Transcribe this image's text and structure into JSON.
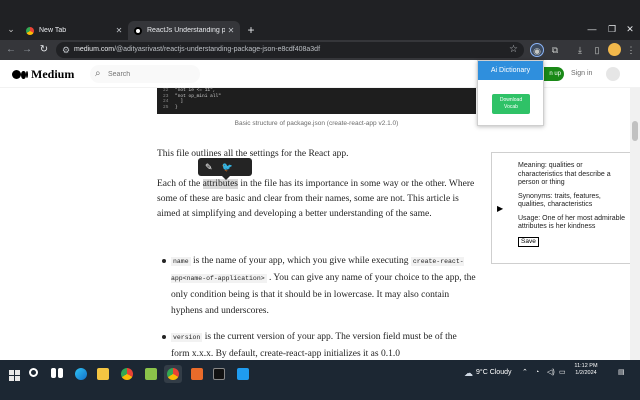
{
  "browser": {
    "tabs": [
      {
        "title": "New Tab",
        "active": false
      },
      {
        "title": "ReactJs Understanding packag",
        "active": true
      }
    ],
    "url_domain": "medium.com",
    "url_path": "/@adityasrivast/reactjs-understanding-package-json-e8cdf408a3df"
  },
  "medium": {
    "logo_text": "Medium",
    "search_placeholder": "Search",
    "signup_label": "n up",
    "signin_label": "Sign in"
  },
  "article": {
    "code_lines": [
      {
        "no": "22",
        "text": "\"not ie <= 11\","
      },
      {
        "no": "23",
        "text": "\"not op_mini all\""
      },
      {
        "no": "24",
        "text": "  ]"
      },
      {
        "no": "25",
        "text": "}"
      }
    ],
    "caption": "Basic structure of package.json (create-react-app v2.1.0)",
    "para1": "This file outlines all the settings for the React app.",
    "para2_before": "Each of the ",
    "para2_highlight": "attributes",
    "para2_after": " in the file has its importance in some way or the other. Where some of these are basic and clear from their names, some are not. This article is aimed at simplifying and developing a better understanding of the same.",
    "bullet1_code1": "name",
    "bullet1_text1": " is the name of your app, which you give while executing ",
    "bullet1_code2": "create-react-app<name-of-application>",
    "bullet1_text2": " . You can give any name of your choice to the app, the only condition being is that it should be in lowercase. It may also contain hyphens and underscores.",
    "bullet2_code1": "version",
    "bullet2_text1": " is the current version of your app. The version field must be of the form x.x.x. By default, create-react-app initializes it as 0.1.0"
  },
  "ai_dictionary": {
    "title": "Ai Dictionary",
    "download_label_1": "Download",
    "download_label_2": "Vocab"
  },
  "meaning_panel": {
    "meaning": "Meaning: qualities or characteristics that describe a person or thing",
    "synonyms": "Synonyms: traits, features, qualities, characteristics",
    "usage": "Usage: One of her most admirable attributes is her kindness",
    "save_label": "Save"
  },
  "taskbar": {
    "weather": "9°C  Cloudy",
    "time": "11:12 PM",
    "date": "1/2/2024"
  }
}
